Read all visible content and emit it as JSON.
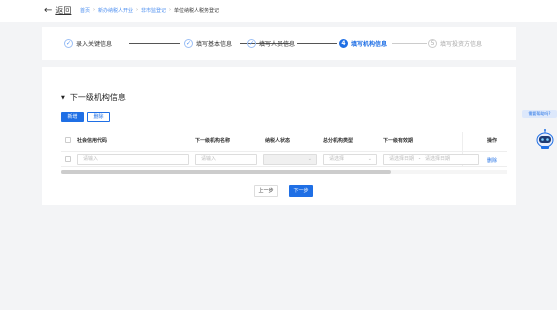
{
  "header": {
    "back_label": "返回",
    "breadcrumb": [
      "首页",
      "新办纳税人开业",
      "非市监登记",
      "单位纳税人税务登记"
    ]
  },
  "steps": [
    {
      "label": "录入关键信息",
      "status": "done",
      "num": "✓"
    },
    {
      "label": "填写基本信息",
      "status": "done",
      "num": "✓"
    },
    {
      "label": "填写人员信息",
      "status": "done",
      "num": "✓"
    },
    {
      "label": "填写机构信息",
      "status": "active",
      "num": "4"
    },
    {
      "label": "填写投资方信息",
      "status": "todo",
      "num": "5"
    }
  ],
  "section": {
    "title": "下一级机构信息",
    "add_label": "新增",
    "delete_label": "删除"
  },
  "table": {
    "columns": [
      "社会信用代码",
      "下一级机构名称",
      "纳税人状态",
      "总分机构类型",
      "下一级有效期",
      "操作"
    ],
    "row": {
      "credit_code_placeholder": "请输入",
      "name_placeholder": "请输入",
      "status_value": "",
      "type_placeholder": "请选择",
      "start_date_placeholder": "请选择日期",
      "date_separator": "-",
      "end_date_placeholder": "请选择日期",
      "action_label": "删除"
    }
  },
  "footer": {
    "prev_label": "上一步",
    "next_label": "下一步"
  },
  "side": {
    "pill_label": "需要帮助吗?"
  },
  "colors": {
    "primary": "#1f6fe5",
    "background": "#f3f4f6"
  }
}
